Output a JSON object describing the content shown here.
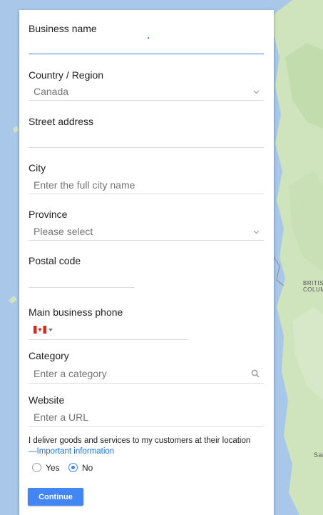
{
  "map": {
    "labels": [
      "BRITIS",
      "COLUM",
      "Sar"
    ]
  },
  "form": {
    "business_name": {
      "label": "Business name",
      "value": ""
    },
    "country": {
      "label": "Country / Region",
      "value": "Canada"
    },
    "street": {
      "label": "Street address",
      "value": ""
    },
    "city": {
      "label": "City",
      "placeholder": "Enter the full city name"
    },
    "province": {
      "label": "Province",
      "placeholder": "Please select"
    },
    "postal": {
      "label": "Postal code",
      "value": ""
    },
    "phone": {
      "label": "Main business phone",
      "value": ""
    },
    "category": {
      "label": "Category",
      "placeholder": "Enter a category"
    },
    "website": {
      "label": "Website",
      "placeholder": "Enter a URL"
    },
    "deliver": {
      "text": "I deliver goods and services to my customers at their location",
      "link": "—Important information",
      "options": [
        "Yes",
        "No"
      ],
      "selected": "No"
    },
    "continue_label": "Continue"
  },
  "colors": {
    "accent": "#4285f4",
    "map_water": "#a9c7e9",
    "map_land": "#cfe3bd",
    "link": "#1a73e8"
  }
}
